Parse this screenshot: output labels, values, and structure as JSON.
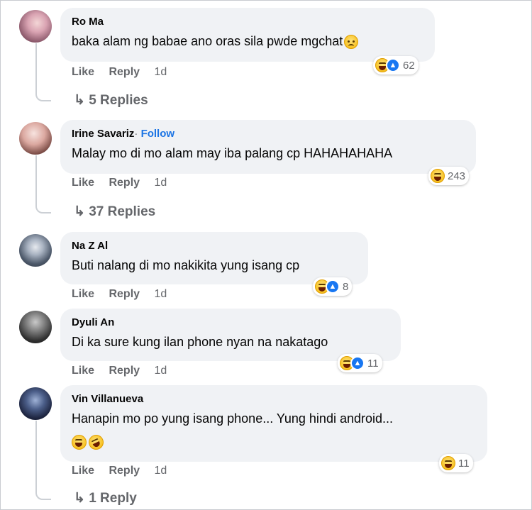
{
  "comments": [
    {
      "author": "Ro Ma",
      "text": "baka alam ng babae ano oras sila pwde mgchat",
      "reaction_count": "62",
      "actions": {
        "like": "Like",
        "reply": "Reply",
        "time": "1d"
      },
      "replies": "5 Replies"
    },
    {
      "author": "Irine Savariz",
      "separator": "·",
      "follow": "Follow",
      "text": "Malay mo di mo alam may iba palang cp HAHAHAHAHA",
      "reaction_count": "243",
      "actions": {
        "like": "Like",
        "reply": "Reply",
        "time": "1d"
      },
      "replies": "37 Replies"
    },
    {
      "author": "Na Z Al",
      "text": "Buti nalang di mo nakikita yung isang cp",
      "reaction_count": "8",
      "actions": {
        "like": "Like",
        "reply": "Reply",
        "time": "1d"
      }
    },
    {
      "author": "Dyuli An",
      "text": "Di ka sure kung ilan phone nyan na nakatago",
      "reaction_count": "11",
      "actions": {
        "like": "Like",
        "reply": "Reply",
        "time": "1d"
      }
    },
    {
      "author": "Vin Villanueva",
      "text": "Hanapin mo po yung isang phone... Yung hindi android...",
      "reaction_count": "11",
      "actions": {
        "like": "Like",
        "reply": "Reply",
        "time": "1d"
      },
      "replies": "1 Reply"
    }
  ],
  "colors": {
    "link": "#1b74e4",
    "bubble": "#f0f2f5",
    "meta": "#65676b",
    "like_blue": "#1877f2",
    "haha_yellow": "#f4b400"
  },
  "icons": [
    "haha-reaction-icon",
    "like-reaction-icon",
    "sad-emoji-icon",
    "reply-arrow-icon",
    "laughing-emoji-icon",
    "rofl-emoji-icon"
  ]
}
